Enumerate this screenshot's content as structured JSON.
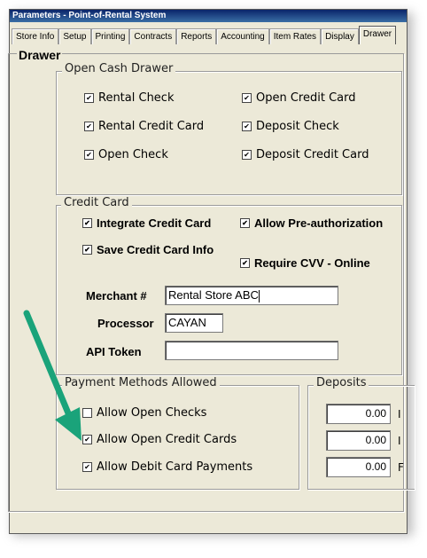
{
  "window": {
    "title": "Parameters - Point-of-Rental System"
  },
  "tabs": [
    "Store Info",
    "Setup",
    "Printing",
    "Contracts",
    "Reports",
    "Accounting",
    "Item Rates",
    "Display",
    "Drawer"
  ],
  "active_tab": "Drawer",
  "panel_title": "Drawer",
  "open_cash_drawer": {
    "title": "Open Cash Drawer",
    "items": [
      {
        "label": "Rental Check",
        "checked": true
      },
      {
        "label": "Rental Credit Card",
        "checked": true
      },
      {
        "label": "Open Check",
        "checked": true
      },
      {
        "label": "Open Credit Card",
        "checked": true
      },
      {
        "label": "Deposit Check",
        "checked": true
      },
      {
        "label": "Deposit Credit Card",
        "checked": true
      }
    ]
  },
  "credit_card": {
    "title": "Credit Card",
    "integrate": {
      "label": "Integrate Credit Card",
      "checked": true
    },
    "save_info": {
      "label": "Save Credit Card Info",
      "checked": true
    },
    "allow_preauth": {
      "label": "Allow Pre-authorization",
      "checked": true
    },
    "require_cvv": {
      "label": "Require CVV - Online",
      "checked": true
    },
    "merchant_label": "Merchant #",
    "merchant_value": "Rental Store ABC",
    "processor_label": "Processor",
    "processor_value": "CAYAN",
    "api_token_label": "API Token",
    "api_token_value": ""
  },
  "payment_methods": {
    "title": "Payment Methods Allowed",
    "items": [
      {
        "label": "Allow Open Checks",
        "checked": false
      },
      {
        "label": "Allow Open Credit Cards",
        "checked": true
      },
      {
        "label": "Allow Debit Card Payments",
        "checked": true
      }
    ]
  },
  "deposits": {
    "title": "Deposits",
    "values": [
      "0.00",
      "0.00",
      "0.00"
    ],
    "trailing": [
      "I",
      "I",
      "F"
    ]
  },
  "colors": {
    "arrow": "#1aa37a",
    "titlebar": "#0a246a"
  }
}
